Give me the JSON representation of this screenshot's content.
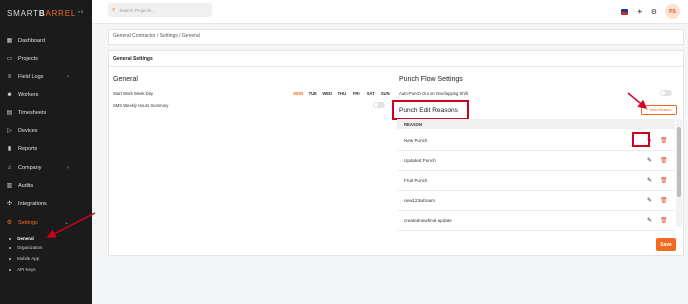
{
  "app": {
    "logo_text": "SMART",
    "logo_bold": "B",
    "logo_bar": "ARREL",
    "version": "v5"
  },
  "sidebar": {
    "items": [
      {
        "label": "Dashboard",
        "icon": "dashboard-icon"
      },
      {
        "label": "Projects",
        "icon": "folder-icon"
      },
      {
        "label": "Field Logs",
        "icon": "field-logs-icon",
        "chevron": "‹"
      },
      {
        "label": "Workers",
        "icon": "workers-icon"
      },
      {
        "label": "Timesheets",
        "icon": "timesheets-icon"
      },
      {
        "label": "Devices",
        "icon": "devices-icon"
      },
      {
        "label": "Reports",
        "icon": "reports-icon"
      },
      {
        "label": "Company",
        "icon": "company-icon",
        "chevron": "‹"
      },
      {
        "label": "Audits",
        "icon": "audits-icon"
      },
      {
        "label": "Integrations",
        "icon": "integrations-icon"
      },
      {
        "label": "Settings",
        "icon": "gear-icon",
        "chevron": "⌄",
        "active": true
      }
    ],
    "subitems": [
      {
        "label": "General",
        "active": true
      },
      {
        "label": "Organization"
      },
      {
        "label": "Mobile App"
      },
      {
        "label": "API Keys"
      }
    ]
  },
  "topbar": {
    "search_placeholder": "Search Projects...",
    "avatar_initials": "PS"
  },
  "breadcrumb": "General Contractor  /  Settings  /  General",
  "card_title": "General Settings",
  "general": {
    "heading": "General",
    "start_week_label": "Start Work Week Day",
    "sms_label": "SMS Weekly Hours Summary",
    "days": [
      "MON",
      "TUE",
      "WED",
      "THU",
      "FRI",
      "SAT",
      "SUN"
    ],
    "selected_day": "MON"
  },
  "punch_flow": {
    "heading": "Punch Flow Settings",
    "auto_punch_label": "Auto-Punch Out on Overlapping Shift"
  },
  "punch_reasons": {
    "heading": "Punch Edit Reasons",
    "new_button": "+ New Reason",
    "column_header": "REASON",
    "rows": [
      "New Punch",
      "Updated Punch",
      "Fruit Punch",
      "new123whoam",
      "creatednewfinal-update"
    ]
  },
  "save_label": "Save",
  "colors": {
    "accent": "#f26a21",
    "annotation_red": "#d0021b",
    "sidebar_bg": "#1b1b1b"
  }
}
